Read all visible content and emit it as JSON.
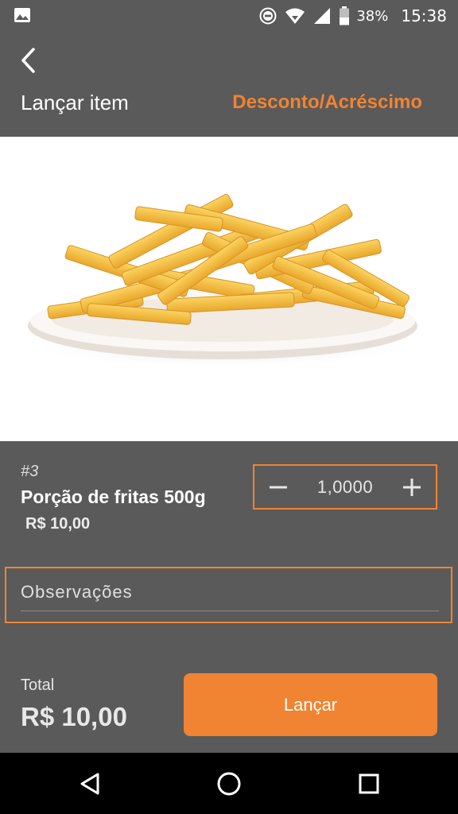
{
  "status_bar": {
    "battery_percent": "38%",
    "time": "15:38",
    "icons": [
      "image-icon",
      "do-not-disturb-icon",
      "wifi-icon",
      "signal-icon",
      "battery-icon"
    ]
  },
  "header": {
    "title": "Lançar item",
    "action_label": "Desconto/Acréscimo",
    "back_icon": "chevron-left-icon"
  },
  "item": {
    "number": "#3",
    "name": "Porção de fritas 500g",
    "price": "R$ 10,00",
    "image": "french-fries-plate"
  },
  "quantity": {
    "value": "1,0000",
    "minus_icon": "minus-icon",
    "plus_icon": "plus-icon"
  },
  "observations": {
    "placeholder": "Observações",
    "value": ""
  },
  "footer": {
    "total_label": "Total",
    "total_value": "R$ 10,00",
    "submit_label": "Lançar"
  },
  "nav": {
    "back": "back-triangle-icon",
    "home": "home-circle-icon",
    "recents": "recents-square-icon"
  },
  "colors": {
    "accent": "#f08433",
    "background": "#5a5a5a",
    "image_bg": "#ffffff",
    "nav_bg": "#000000"
  }
}
